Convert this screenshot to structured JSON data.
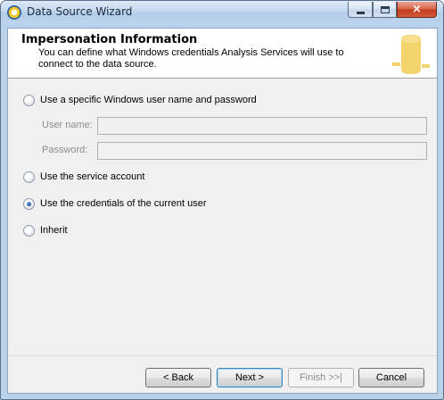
{
  "window": {
    "title": "Data Source Wizard",
    "icon": "wizard-app-icon",
    "controls": {
      "minimize": "minimize-icon",
      "maximize": "maximize-icon",
      "close": "×"
    }
  },
  "header": {
    "title": "Impersonation Information",
    "description_line1": "You can define what Windows credentials Analysis Services will use to",
    "description_line2": "connect to the data source.",
    "art_icon": "database-cylinder-icon"
  },
  "options": {
    "specific_user": {
      "label": "Use a specific Windows user name and password",
      "selected": false
    },
    "user_name": {
      "label": "User name:",
      "value": ""
    },
    "password": {
      "label": "Password:",
      "value": ""
    },
    "service_account": {
      "label": "Use the service account",
      "selected": false
    },
    "current_user": {
      "label": "Use the credentials of the current user",
      "selected": true
    },
    "inherit": {
      "label": "Inherit",
      "selected": false
    }
  },
  "buttons": {
    "back": "< Back",
    "next": "Next >",
    "finish": "Finish >>|",
    "cancel": "Cancel"
  },
  "colors": {
    "title_bar": "#c4d8ee",
    "close_button": "#c23c1f",
    "client_bg": "#f0f0f0",
    "art_fill": "#f3d36b"
  }
}
